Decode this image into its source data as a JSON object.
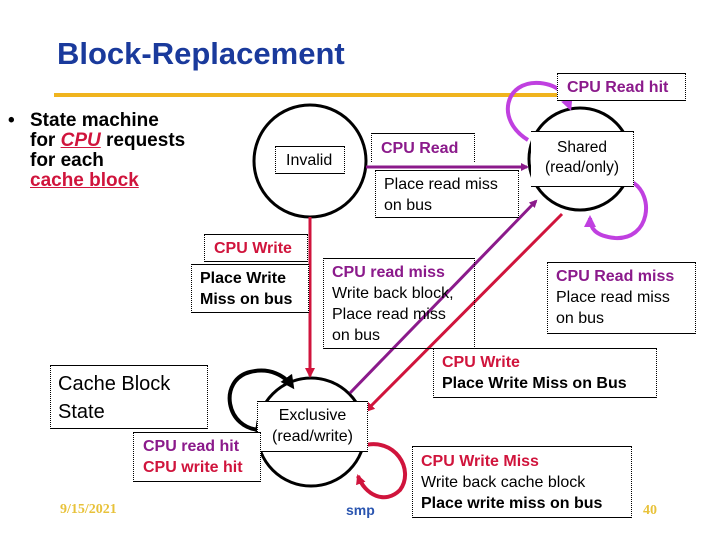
{
  "slide": {
    "title": "Block-Replacement",
    "bullet": {
      "symbol": "•",
      "line1": "State machine",
      "line2_pre": "for ",
      "line2_link": "CPU",
      "line2_post": " requests",
      "line3": "for each",
      "line4_link": "cache block"
    },
    "states": {
      "invalid": "Invalid",
      "shared_l1": "Shared",
      "shared_l2": "(read/only)",
      "exclusive_l1": "Exclusive",
      "exclusive_l2": "(read/write)"
    },
    "labels": {
      "cpu_read_hit": "CPU Read hit",
      "cpu_read": "CPU Read",
      "place_read_miss_l1": "Place read miss",
      "place_read_miss_l2": "on bus",
      "cpu_write": "CPU Write",
      "place_write_l1": "Place Write",
      "place_write_l2": "Miss on bus",
      "cpu_read_miss_title": "CPU read miss",
      "cpu_read_miss_l1": "Write back block,",
      "cpu_read_miss_l2": "Place read miss",
      "cpu_read_miss_l3": "on bus",
      "shared_read_miss_title": "CPU Read miss",
      "shared_read_miss_l1": "Place read miss",
      "shared_read_miss_l2": "on bus",
      "shared_write_title": "CPU Write",
      "shared_write_l1": "Place Write Miss on Bus",
      "cache_block_state_l1": "Cache Block",
      "cache_block_state_l2": "State",
      "cpu_read_hit_excl": "CPU read hit",
      "cpu_write_hit_excl": "CPU write hit",
      "write_miss_title": "CPU Write Miss",
      "write_miss_l1": "Write back cache block",
      "write_miss_l2": "Place write miss on bus"
    },
    "footer": {
      "date": "9/15/2021",
      "center": "smp",
      "page": "40"
    },
    "colors": {
      "title": "#1a3a9c",
      "rule": "#f0b41e",
      "purple": "#8b1a8b",
      "magenta_loop": "#c040e0",
      "red": "#d0143c"
    }
  }
}
